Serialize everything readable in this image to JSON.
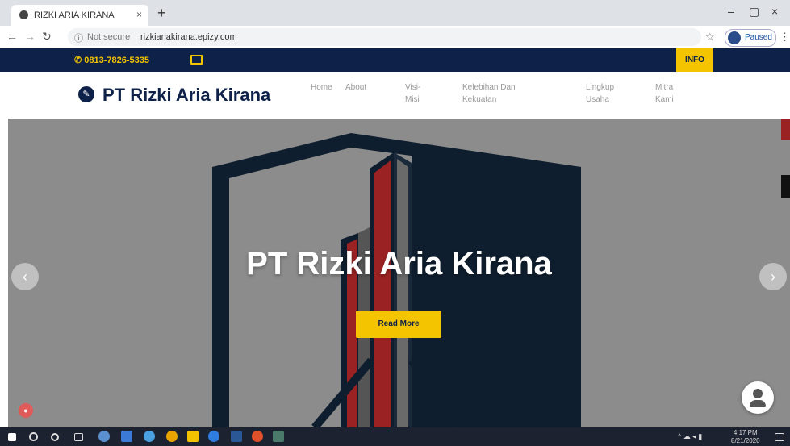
{
  "browser": {
    "tab_title": "RIZKI ARIA KIRANA",
    "tab_close": "×",
    "new_tab": "+",
    "security_label": "Not secure",
    "url": "rizkiariakirana.epizy.com",
    "profile_label": "Paused",
    "window_controls": [
      "–",
      "▢",
      "×"
    ]
  },
  "topbar": {
    "phone": "0813-7826-5335",
    "info_label": "INFO"
  },
  "header": {
    "brand": "PT Rizki Aria Kirana",
    "menu": [
      "Home",
      "About",
      "Visi-\nMisi",
      "Kelebihan Dan\nKekuatan",
      "Lingkup\nUsaha",
      "Mitra\nKami"
    ]
  },
  "hero": {
    "title": "PT Rizki Aria Kirana",
    "button_label": "Read More",
    "prev": "‹",
    "next": "›"
  },
  "taskbar": {
    "clock_time": "4:17 PM",
    "clock_date": "8/21/2020"
  },
  "colors": {
    "navy": "#0d2149",
    "accent": "#f4c400",
    "hero_red": "#9b2222"
  }
}
